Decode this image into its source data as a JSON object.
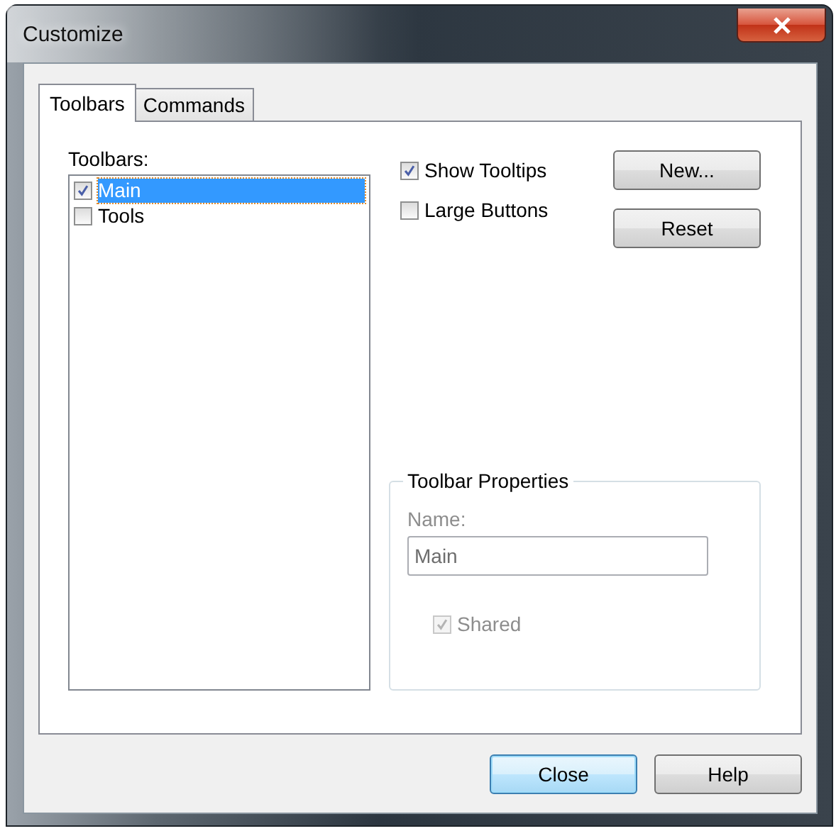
{
  "window": {
    "title": "Customize"
  },
  "tabs": [
    {
      "label": "Toolbars",
      "selected": true
    },
    {
      "label": "Commands",
      "selected": false
    }
  ],
  "toolbars_label": "Toolbars:",
  "toolbars": [
    {
      "label": "Main",
      "checked": true,
      "selected": true
    },
    {
      "label": "Tools",
      "checked": false,
      "selected": false
    }
  ],
  "options": [
    {
      "label": "Show Tooltips",
      "checked": true
    },
    {
      "label": "Large Buttons",
      "checked": false
    }
  ],
  "side_buttons": [
    "New...",
    "Reset"
  ],
  "toolbar_properties": {
    "title": "Toolbar Properties",
    "disabled": true,
    "name_label": "Name:",
    "name_value": "Main",
    "shared": {
      "label": "Shared",
      "checked": true
    }
  },
  "buttons": [
    {
      "label": "Close",
      "default": true
    },
    {
      "label": "Help",
      "default": false
    }
  ]
}
